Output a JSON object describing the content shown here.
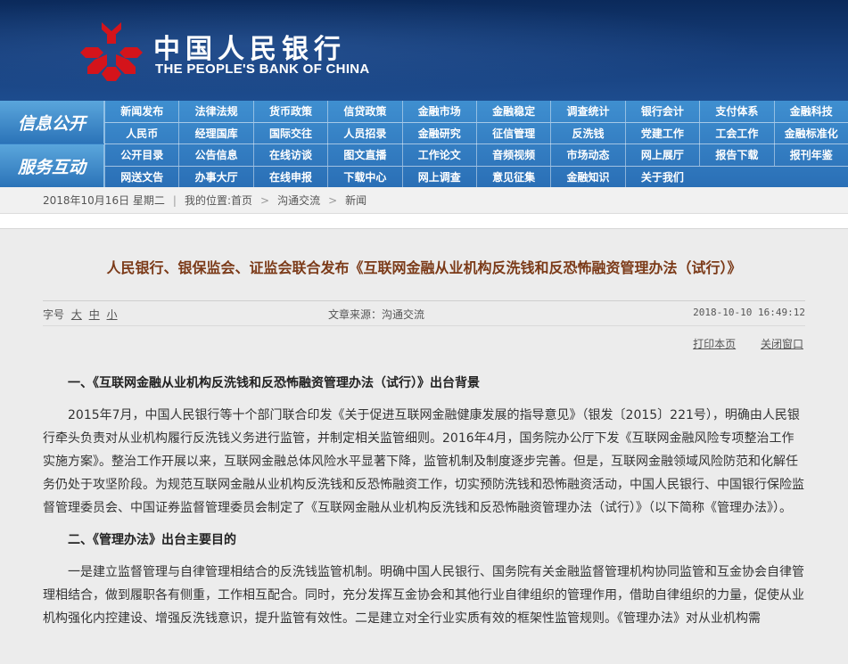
{
  "header": {
    "cn_name": "中国人民银行",
    "en_name": "THE PEOPLE'S BANK OF CHINA"
  },
  "nav": {
    "section1_label": "信息公开",
    "section2_label": "服务互动",
    "rows": [
      [
        "新闻发布",
        "法律法规",
        "货币政策",
        "信贷政策",
        "金融市场",
        "金融稳定",
        "调查统计",
        "银行会计",
        "支付体系",
        "金融科技"
      ],
      [
        "人民币",
        "经理国库",
        "国际交往",
        "人员招录",
        "金融研究",
        "征信管理",
        "反洗钱",
        "党建工作",
        "工会工作",
        "金融标准化"
      ],
      [
        "公开目录",
        "公告信息",
        "在线访谈",
        "图文直播",
        "工作论文",
        "音频视频",
        "市场动态",
        "网上展厅",
        "报告下载",
        "报刊年鉴"
      ],
      [
        "网送文告",
        "办事大厅",
        "在线申报",
        "下载中心",
        "网上调查",
        "意见征集",
        "金融知识",
        "关于我们"
      ]
    ]
  },
  "breadcrumb": {
    "date": "2018年10月16日 星期二",
    "location_label": "我的位置:",
    "home": "首页",
    "level1": "沟通交流",
    "level2": "新闻"
  },
  "article": {
    "title": "人民银行、银保监会、证监会联合发布《互联网金融从业机构反洗钱和反恐怖融资管理办法（试行）》",
    "font_size_label": "字号",
    "font_size_large": "大",
    "font_size_medium": "中",
    "font_size_small": "小",
    "source": "文章来源：沟通交流",
    "datetime": "2018-10-10 16:49:12",
    "print_label": "打印本页",
    "close_label": "关闭窗口",
    "heading1": "一、《互联网金融从业机构反洗钱和反恐怖融资管理办法（试行）》出台背景",
    "para1": "2015年7月，中国人民银行等十个部门联合印发《关于促进互联网金融健康发展的指导意见》（银发〔2015〕221号），明确由人民银行牵头负责对从业机构履行反洗钱义务进行监管，并制定相关监管细则。2016年4月，国务院办公厅下发《互联网金融风险专项整治工作实施方案》。整治工作开展以来，互联网金融总体风险水平显著下降，监管机制及制度逐步完善。但是，互联网金融领域风险防范和化解任务仍处于攻坚阶段。为规范互联网金融从业机构反洗钱和反恐怖融资工作，切实预防洗钱和恐怖融资活动，中国人民银行、中国银行保险监督管理委员会、中国证券监督管理委员会制定了《互联网金融从业机构反洗钱和反恐怖融资管理办法（试行）》（以下简称《管理办法》）。",
    "heading2": "二、《管理办法》出台主要目的",
    "para2": "一是建立监督管理与自律管理相结合的反洗钱监管机制。明确中国人民银行、国务院有关金融监督管理机构协同监管和互金协会自律管理相结合，做到履职各有侧重，工作相互配合。同时，充分发挥互金协会和其他行业自律组织的管理作用，借助自律组织的力量，促使从业机构强化内控建设、增强反洗钱意识，提升监管有效性。二是建立对全行业实质有效的框架性监管规则。《管理办法》对从业机构需"
  }
}
